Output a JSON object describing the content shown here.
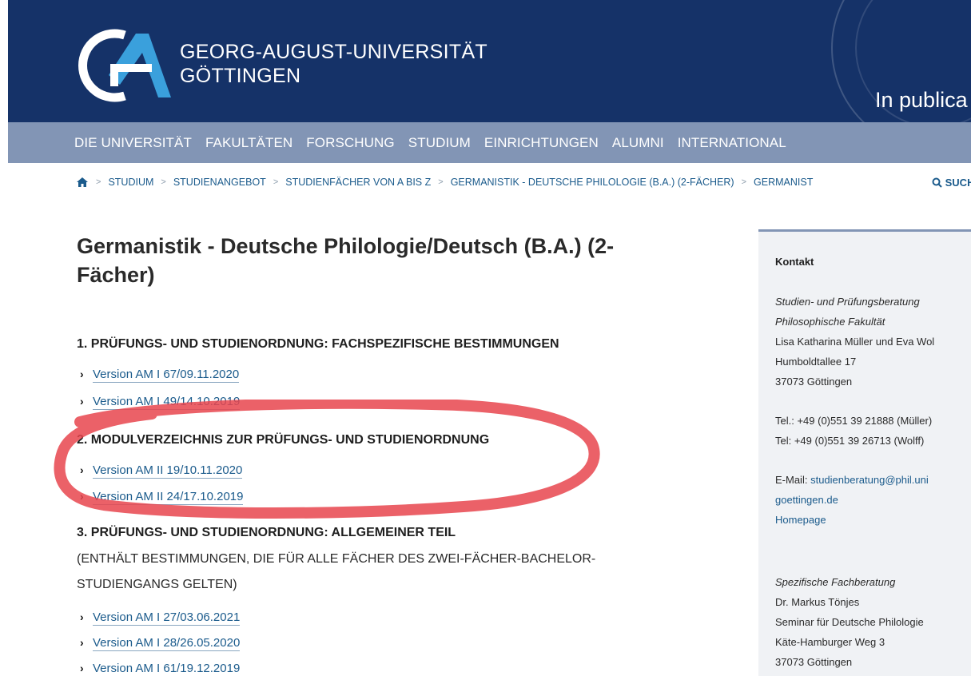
{
  "header": {
    "logo_line1": "GEORG-AUGUST-UNIVERSITÄT",
    "logo_line2": "GÖTTINGEN",
    "motto": "In publica",
    "brand_color": "#153268"
  },
  "nav": {
    "items": [
      "DIE UNIVERSITÄT",
      "FAKULTÄTEN",
      "FORSCHUNG",
      "STUDIUM",
      "EINRICHTUNGEN",
      "ALUMNI",
      "INTERNATIONAL"
    ],
    "color": "#8295b5"
  },
  "breadcrumb": {
    "home_icon": "home-icon",
    "items": [
      "STUDIUM",
      "STUDIENANGEBOT",
      "STUDIENFÄCHER VON A BIS Z",
      "GERMANISTIK - DEUTSCHE PHILOLOGIE (B.A.) (2-FÄCHER)",
      "GERMANIST"
    ],
    "search_label": "SUCH"
  },
  "main": {
    "title": "Germanistik - Deutsche Philologie/Deutsch (B.A.) (2-Fächer)",
    "sections": [
      {
        "heading": "1. PRÜFUNGS- UND STUDIENORDNUNG: FACHSPEZIFISCHE BESTIMMUNGEN",
        "links": [
          "Version AM I 67/09.11.2020",
          "Version AM I 49/14.10.2019"
        ]
      },
      {
        "heading": "2. MODULVERZEICHNIS ZUR PRÜFUNGS- UND STUDIENORDNUNG",
        "links": [
          "Version AM II 19/10.11.2020",
          "Version AM II 24/17.10.2019"
        ]
      },
      {
        "heading": "3. PRÜFUNGS- UND STUDIENORDNUNG: ALLGEMEINER TEIL",
        "subtext": "(ENTHÄLT BESTIMMUNGEN, DIE FÜR ALLE FÄCHER DES ZWEI-FÄCHER-BACHELOR-STUDIENGANGS GELTEN)",
        "links": [
          "Version AM I 27/03.06.2021",
          "Version AM I 28/26.05.2020",
          "Version AM I 61/19.12.2019"
        ]
      }
    ]
  },
  "sidebar": {
    "heading": "Kontakt",
    "contact1_role": "Studien- und Prüfungsberatung",
    "contact1_faculty": "Philosophische Fakultät",
    "contact1_names": "Lisa Katharina Müller und Eva Wol",
    "contact1_street": "Humboldtallee 17",
    "contact1_city": "37073 Göttingen",
    "phone1": "Tel.: +49 (0)551 39 21888 (Müller)",
    "phone2": "Tel: +49 (0)551 39 26713 (Wolff)",
    "email_label": "E-Mail:",
    "email_part1": "studienberatung@phil.uni",
    "email_part2": "goettingen.de",
    "homepage": "Homepage",
    "contact2_role": "Spezifische Fachberatung",
    "contact2_name": "Dr. Markus Tönjes",
    "contact2_dept": "Seminar für Deutsche Philologie",
    "contact2_street": "Käte-Hamburger Weg 3",
    "contact2_city": "37073 Göttingen"
  },
  "annotation_color": "#e8454e"
}
